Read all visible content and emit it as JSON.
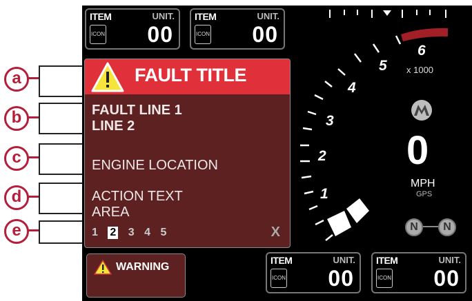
{
  "callouts": [
    "a",
    "b",
    "c",
    "d",
    "e"
  ],
  "top_items": [
    {
      "name": "ITEM",
      "unit": "UNIT.",
      "icon": "ICON",
      "value": "00"
    },
    {
      "name": "ITEM",
      "unit": "UNIT.",
      "icon": "ICON",
      "value": "00"
    }
  ],
  "bottom_items": [
    {
      "name": "ITEM",
      "unit": "UNIT.",
      "icon": "ICON",
      "value": "00"
    },
    {
      "name": "ITEM",
      "unit": "UNIT.",
      "icon": "ICON",
      "value": "00"
    }
  ],
  "fault": {
    "title": "FAULT TITLE",
    "line1": "FAULT LINE 1",
    "line2": "LINE 2",
    "location": "ENGINE LOCATION",
    "action1": "ACTION TEXT",
    "action2": "AREA",
    "pages": [
      "1",
      "2",
      "3",
      "4",
      "5"
    ],
    "selected_page": "2",
    "close": "X"
  },
  "warning": {
    "label": "WARNING"
  },
  "tach": {
    "labels": [
      "1",
      "2",
      "3",
      "4",
      "5",
      "6"
    ],
    "multiplier": "x 1000"
  },
  "speed": {
    "value": "0",
    "unit": "MPH",
    "source": "GPS"
  },
  "gear": {
    "left": "N",
    "right": "N"
  },
  "colors": {
    "accent": "#b31e3a",
    "fault_panel": "#5e2121",
    "fault_title": "#e0303a",
    "warning_icon": "#f5e43a"
  }
}
